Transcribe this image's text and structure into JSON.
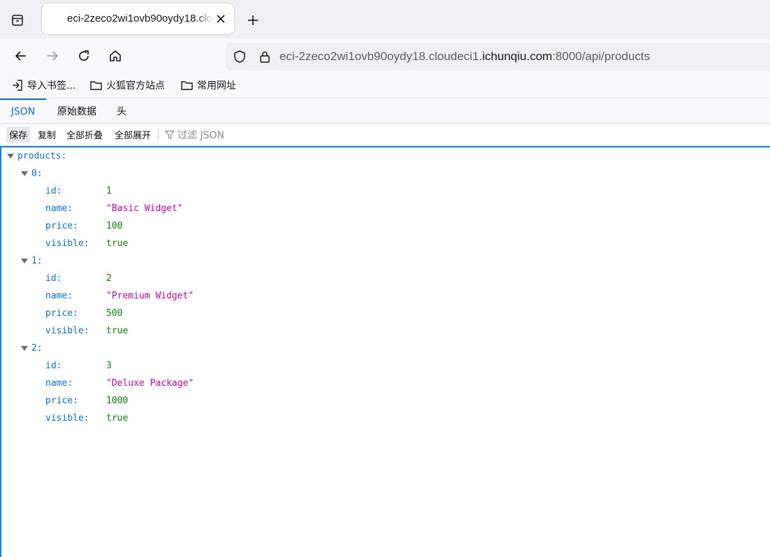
{
  "browser": {
    "tab": {
      "title": "eci-2zeco2wi1ovb90oydy18.cloudeci1.ichunqiu.com:8000/api/products"
    },
    "url": {
      "prefix": "eci-2zeco2wi1ovb90oydy18.cloudeci1.",
      "domain": "ichunqiu.com",
      "suffix": ":8000/api/products"
    },
    "bookmarks": [
      {
        "label": "导入书签...",
        "icon": "import-icon"
      },
      {
        "label": "火狐官方站点",
        "icon": "folder-icon"
      },
      {
        "label": "常用网址",
        "icon": "folder-icon"
      }
    ]
  },
  "viewer": {
    "tabs": [
      {
        "label": "JSON",
        "active": true
      },
      {
        "label": "原始数据",
        "active": false
      },
      {
        "label": "头",
        "active": false
      }
    ],
    "toolbar": {
      "save": "保存",
      "copy": "复制",
      "collapse_all": "全部折叠",
      "expand_all": "全部展开",
      "filter_placeholder": "过滤 JSON"
    }
  },
  "json": {
    "root_key": "products:",
    "items": [
      {
        "index": "0:",
        "id_key": "id:",
        "id": "1",
        "name_key": "name:",
        "name": "\"Basic Widget\"",
        "price_key": "price:",
        "price": "100",
        "visible_key": "visible:",
        "visible": "true"
      },
      {
        "index": "1:",
        "id_key": "id:",
        "id": "2",
        "name_key": "name:",
        "name": "\"Premium Widget\"",
        "price_key": "price:",
        "price": "500",
        "visible_key": "visible:",
        "visible": "true"
      },
      {
        "index": "2:",
        "id_key": "id:",
        "id": "3",
        "name_key": "name:",
        "name": "\"Deluxe Package\"",
        "price_key": "price:",
        "price": "1000",
        "visible_key": "visible:",
        "visible": "true"
      }
    ]
  },
  "colors": {
    "accent": "#0074e8",
    "focus_border": "#0a84ff",
    "key": "#0074e8",
    "string": "#dd00a9",
    "number": "#058b00"
  }
}
